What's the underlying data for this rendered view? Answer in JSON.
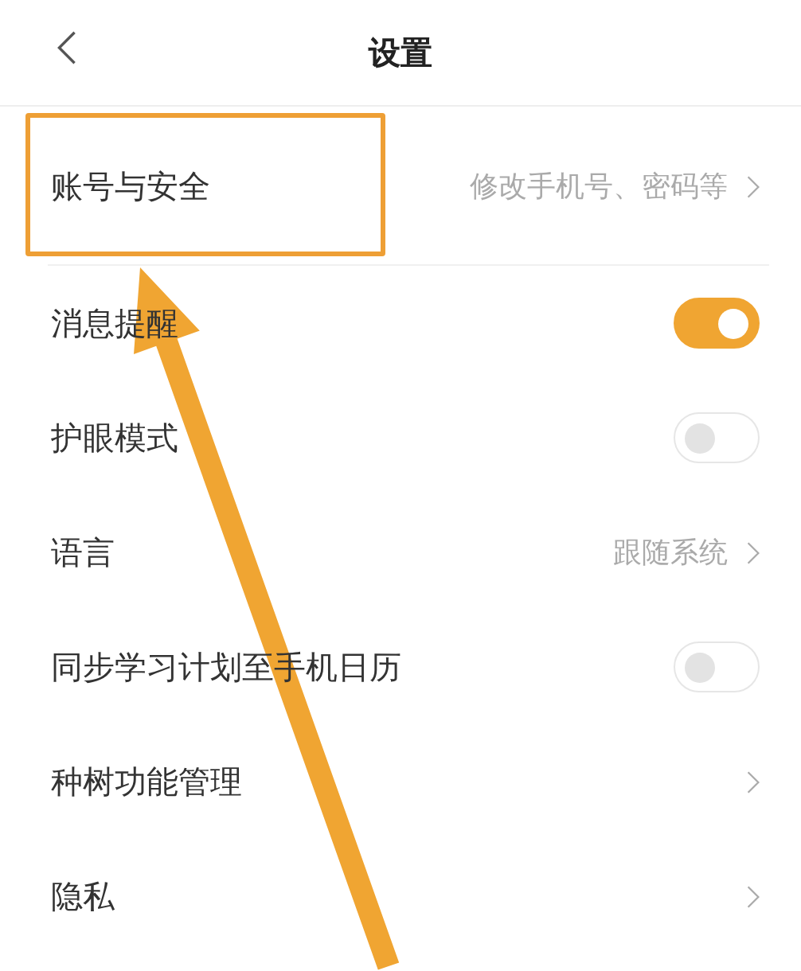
{
  "header": {
    "title": "设置"
  },
  "rows": [
    {
      "kind": "link",
      "label": "账号与安全",
      "value": "修改手机号、密码等",
      "highlighted": true
    },
    {
      "kind": "toggle",
      "label": "消息提醒",
      "on": true,
      "highlighted": false
    },
    {
      "kind": "toggle",
      "label": "护眼模式",
      "on": false,
      "highlighted": false
    },
    {
      "kind": "link",
      "label": "语言",
      "value": "跟随系统",
      "highlighted": false
    },
    {
      "kind": "toggle",
      "label": "同步学习计划至手机日历",
      "on": false,
      "highlighted": false
    },
    {
      "kind": "link",
      "label": "种树功能管理",
      "highlighted": false
    },
    {
      "kind": "link",
      "label": "隐私",
      "highlighted": false
    }
  ]
}
